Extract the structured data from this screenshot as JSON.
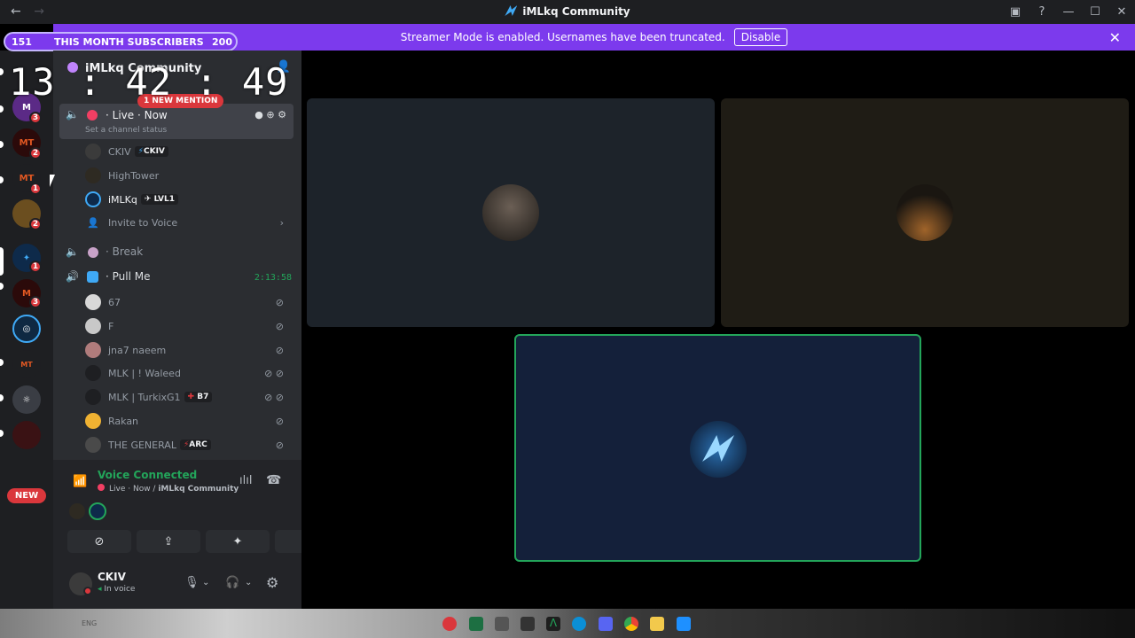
{
  "titlebar": {
    "back": "←",
    "forward": "→",
    "title": "iMLkq Community",
    "inbox_icon": "inbox-icon",
    "help": "?",
    "minimize": "—",
    "maximize": "☐",
    "close": "✕"
  },
  "banner": {
    "text": "Streamer Mode is enabled. Usernames have been truncated.",
    "disable_label": "Disable",
    "close": "✕"
  },
  "subscribers": {
    "current": "151",
    "label": "THIS MONTH SUBSCRIBERS",
    "goal": "200"
  },
  "overlay_clock": "13 : 42 : 49",
  "guild_badges": [
    "1",
    "3",
    "2",
    "1",
    "2",
    "1",
    "3"
  ],
  "guilds": {
    "new_label": "NEW"
  },
  "server": {
    "name": "iMLkq Community",
    "mention_pill": "1 NEW MENTION"
  },
  "channels": {
    "live": {
      "name": "Live",
      "status_now": "Now",
      "hint": "Set a channel status",
      "members": [
        {
          "name": "CKIV",
          "tag": "CKIV",
          "tag_icon": "⚡"
        },
        {
          "name": "HighTower",
          "tag": "",
          "tag_icon": ""
        },
        {
          "name": "iMLKq",
          "tag": "LVL1",
          "tag_icon": "✈"
        }
      ],
      "invite": "Invite to Voice"
    },
    "break": {
      "name": "Break"
    },
    "pull": {
      "name": "Pull Me",
      "timer": "2:13:58",
      "members": [
        {
          "name": "67",
          "tag": ""
        },
        {
          "name": "F",
          "tag": ""
        },
        {
          "name": "jna7 naeem",
          "tag": ""
        },
        {
          "name": "MLK | ! Waleed",
          "tag": ""
        },
        {
          "name": "MLK | TurkixG1",
          "tag": "B7"
        },
        {
          "name": "Rakan",
          "tag": ""
        },
        {
          "name": "THE GENERAL",
          "tag": "ARC"
        }
      ]
    }
  },
  "voice": {
    "status": "Voice Connected",
    "location_prefix": "Live · Now / ",
    "location_server": "iMLkq Community"
  },
  "user_panel": {
    "name": "CKIV",
    "status": "In voice"
  },
  "tray": {
    "lang": "ENG"
  },
  "colors": {
    "accent": "#7c3aed",
    "connected": "#23a55a",
    "mention": "#da373c",
    "highlight": "#23a55a"
  }
}
